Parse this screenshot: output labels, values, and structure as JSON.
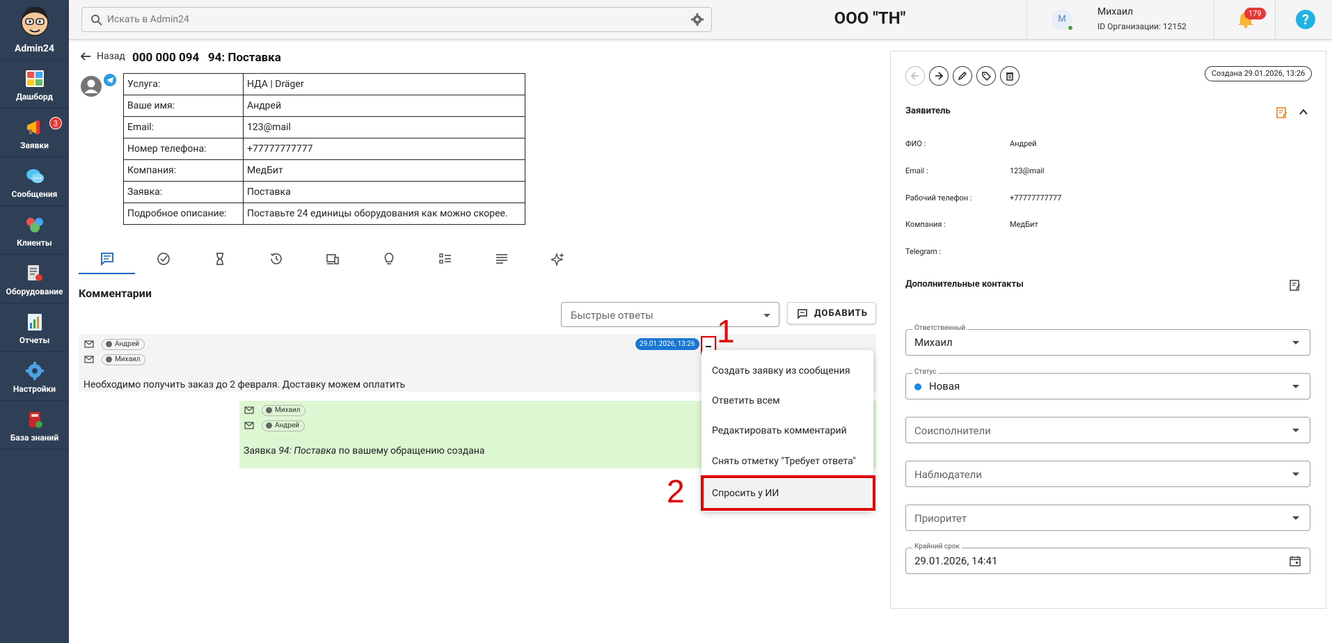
{
  "sidebar": {
    "brand": "Admin24",
    "items": [
      {
        "label": "Дашборд",
        "icon": "dashboard-icon"
      },
      {
        "label": "Заявки",
        "icon": "megaphone-icon",
        "badge": "3"
      },
      {
        "label": "Сообщения",
        "icon": "chat-bubbles-icon"
      },
      {
        "label": "Клиенты",
        "icon": "clients-icon"
      },
      {
        "label": "Оборудование",
        "icon": "equipment-icon"
      },
      {
        "label": "Отчеты",
        "icon": "reports-icon"
      },
      {
        "label": "Настройки",
        "icon": "gear-icon"
      },
      {
        "label": "База знаний",
        "icon": "book-icon"
      }
    ]
  },
  "header": {
    "search_placeholder": "Искать в Admin24",
    "company": "ООО \"ТН\"",
    "avatar_letter": "М",
    "user_name": "Михаил",
    "org_id": "ID Организации: 12152",
    "notifications": "179",
    "help": "?"
  },
  "ticket": {
    "back_label": "Назад",
    "title": "000 000 094   94: Поставка",
    "info_rows": [
      {
        "key": "Услуга:",
        "value": "НДА | Dräger"
      },
      {
        "key": "Ваше имя:",
        "value": "Андрей"
      },
      {
        "key": "Email:",
        "value": "123@mail"
      },
      {
        "key": "Номер телефона:",
        "value": "+77777777777"
      },
      {
        "key": "Компания:",
        "value": "МедБит"
      },
      {
        "key": "Заявка:",
        "value": "Поставка"
      },
      {
        "key": "Подробное описание:",
        "value": "Поставьте 24 единицы оборудования как можно скорее."
      }
    ],
    "tabs": [
      "comments-tab-icon",
      "check-circle-icon",
      "hourglass-icon",
      "history-icon",
      "devices-icon",
      "lightbulb-icon",
      "checklist-icon",
      "text-lines-icon",
      "sparkle-ai-icon"
    ]
  },
  "comments": {
    "title": "Комментарии",
    "quick_replies": "Быстрые ответы",
    "add_label": "ДОБАВИТЬ",
    "messages": [
      {
        "from": "Андрей",
        "to": "Михаил",
        "date": "29.01.2026, 13:26",
        "text": "Необходимо получить заказ до 2 февраля. Доставку можем оплатить"
      },
      {
        "from": "Михаил",
        "to": "Андрей",
        "text_prefix": "Заявка ",
        "text_em": "94: Поставка",
        "text_suffix": " по вашему обращению создана"
      }
    ],
    "menu": [
      "Создать заявку из сообщения",
      "Ответить всем",
      "Редактировать комментарий",
      "Снять отметку \"Требует ответа\"",
      "Спросить у ИИ"
    ],
    "annotations": [
      "1",
      "2"
    ]
  },
  "panel": {
    "created": "Создана 29.01.2026, 13:26",
    "applicant_title": "Заявитель",
    "fields": [
      {
        "key": "ФИО :",
        "value": "Андрей"
      },
      {
        "key": "Email :",
        "value": "123@mail"
      },
      {
        "key": "Рабочий телефон :",
        "value": "+77777777777"
      },
      {
        "key": "Компания :",
        "value": "МедБит"
      },
      {
        "key": "Telegram :",
        "value": ""
      }
    ],
    "extra_contacts": "Дополнительные контакты",
    "responsible_label": "Ответственный",
    "responsible_value": "Михаил",
    "status_label": "Статус",
    "status_value": "Новая",
    "coexecutors": "Соисполнители",
    "observers": "Наблюдатели",
    "priority": "Приоритет",
    "deadline_label": "Крайний срок",
    "deadline_value": "29.01.2026, 14:41",
    "accent": "#e67e22",
    "status_color": "#1e88e5"
  }
}
